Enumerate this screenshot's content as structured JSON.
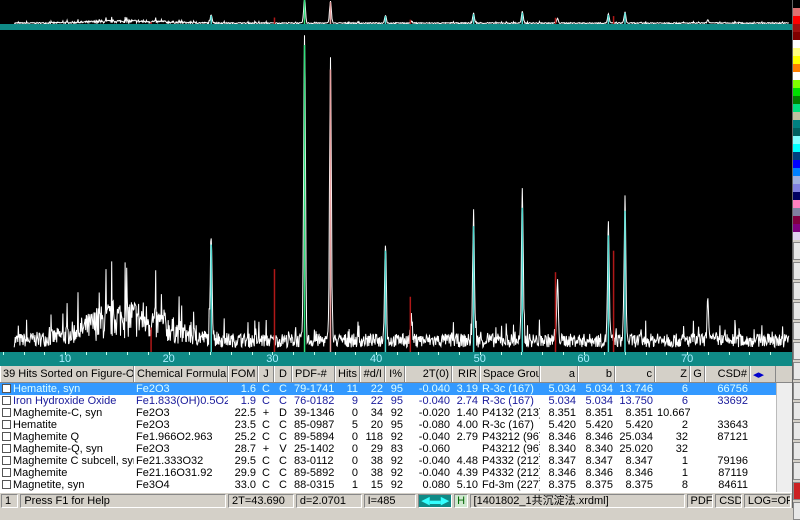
{
  "plot": {
    "x_label_ticks": [
      10,
      20,
      30,
      40,
      50,
      60,
      70
    ],
    "x_range": [
      3.7,
      79.9
    ],
    "observed_peaks": [
      [
        24.1,
        35
      ],
      [
        33.1,
        100
      ],
      [
        35.6,
        92
      ],
      [
        40.9,
        33
      ],
      [
        43.4,
        8
      ],
      [
        49.4,
        41
      ],
      [
        54.1,
        47
      ],
      [
        57.5,
        18
      ],
      [
        62.4,
        38
      ],
      [
        64.0,
        46
      ],
      [
        72.0,
        12
      ]
    ],
    "sticks": [
      {
        "color": "#4dd9d0",
        "pos": [
          [
            24.1,
            35
          ],
          [
            40.9,
            33
          ],
          [
            49.4,
            41
          ],
          [
            54.1,
            47
          ],
          [
            62.4,
            38
          ],
          [
            64.0,
            46
          ]
        ]
      },
      {
        "color": "#b01818",
        "pos": [
          [
            18.3,
            8
          ],
          [
            30.2,
            27
          ],
          [
            43.3,
            18
          ],
          [
            57.3,
            26
          ],
          [
            62.9,
            33
          ]
        ]
      },
      {
        "color": "#e8a0a0",
        "pos": [
          [
            35.6,
            92
          ]
        ]
      },
      {
        "color": "#2ee07a",
        "pos": [
          [
            33.1,
            100
          ]
        ]
      }
    ],
    "pattern_color": "#ffffff",
    "background_color": "#000000",
    "axis_color": "#0f8a86"
  },
  "palette": [
    "#000000",
    "#e07070",
    "#ff0000",
    "#a01010",
    "#800000",
    "#ffffff",
    "#ffff80",
    "#ffff00",
    "#ff8000",
    "#ffffff",
    "#80ff00",
    "#00e000",
    "#008000",
    "#00e080",
    "#c0c0a0",
    "#008080",
    "#006060",
    "#80ffff",
    "#00ffff",
    "#004080",
    "#0000ff",
    "#0080ff",
    "#a0b0e0",
    "#8080e0",
    "#000060",
    "#ff80c0",
    "#8080a0",
    "#800040",
    "#800080",
    "#e0d0f0"
  ],
  "table": {
    "headers": [
      "39 Hits Sorted on Figure-Of-M...",
      "Chemical Formula",
      "FOM",
      "J",
      "D",
      "PDF-#",
      "Hits",
      "#d/I",
      "I%",
      "2T(0)",
      "RIR",
      "Space Group",
      "a",
      "b",
      "c",
      "Z",
      "G",
      "CSD#"
    ],
    "rows": [
      [
        "Hematite, syn",
        "Fe2O3",
        "1.6",
        "C",
        "C",
        "79-1741",
        "11",
        "22",
        "95",
        "-0.040",
        "3.19",
        "R-3c (167)",
        "5.034",
        "5.034",
        "13.746",
        "6",
        "",
        "66756"
      ],
      [
        "Iron Hydroxide Oxide",
        "Fe1.833(OH)0.5O2.5",
        "1.9",
        "C",
        "C",
        "76-0182",
        "9",
        "22",
        "95",
        "-0.040",
        "2.74",
        "R-3c (167)",
        "5.034",
        "5.034",
        "13.750",
        "6",
        "",
        "33692"
      ],
      [
        "Maghemite-C, syn",
        "Fe2O3",
        "22.5",
        "+",
        "D",
        "39-1346",
        "0",
        "34",
        "92",
        "-0.020",
        "1.40",
        "P4132 (213)",
        "8.351",
        "8.351",
        "8.351",
        "10.667",
        "",
        ""
      ],
      [
        "Hematite",
        "Fe2O3",
        "23.5",
        "C",
        "C",
        "85-0987",
        "5",
        "20",
        "95",
        "-0.080",
        "4.00",
        "R-3c (167)",
        "5.420",
        "5.420",
        "5.420",
        "2",
        "",
        "33643"
      ],
      [
        "Maghemite Q",
        "Fe1.966O2.963",
        "25.2",
        "C",
        "C",
        "89-5894",
        "0",
        "118",
        "92",
        "-0.040",
        "2.79",
        "P43212 (96)",
        "8.346",
        "8.346",
        "25.034",
        "32",
        "",
        "87121"
      ],
      [
        "Maghemite-Q, syn",
        "Fe2O3",
        "28.7",
        "+",
        "V",
        "25-1402",
        "0",
        "29",
        "83",
        "-0.060",
        "",
        "P43212 (96)",
        "8.340",
        "8.340",
        "25.020",
        "32",
        "",
        ""
      ],
      [
        "Maghemite C subcell, syn",
        "Fe21.333O32",
        "29.5",
        "C",
        "C",
        "83-0112",
        "0",
        "38",
        "92",
        "-0.040",
        "4.48",
        "P4332 (212)",
        "8.347",
        "8.347",
        "8.347",
        "1",
        "",
        "79196"
      ],
      [
        "Maghemite",
        "Fe21.16O31.92",
        "29.9",
        "C",
        "C",
        "89-5892",
        "0",
        "38",
        "92",
        "-0.040",
        "4.39",
        "P4332 (212)",
        "8.346",
        "8.346",
        "8.346",
        "1",
        "",
        "87119"
      ],
      [
        "Magnetite, syn",
        "Fe3O4",
        "33.0",
        "C",
        "C",
        "88-0315",
        "1",
        "15",
        "92",
        "0.080",
        "5.10",
        "Fd-3m (227)",
        "8.375",
        "8.375",
        "8.375",
        "8",
        "",
        "84611"
      ]
    ]
  },
  "status": {
    "pane": "1",
    "help": "Press F1 for Help",
    "two_theta": "2T=43.690",
    "d": "d=2.0701",
    "intensity": "I=485",
    "h_button": "H",
    "file": "[1401802_1共沉淀法.xrdml]",
    "pdf": "PDF",
    "csd": "CSD",
    "log": "LOG=OFF"
  }
}
